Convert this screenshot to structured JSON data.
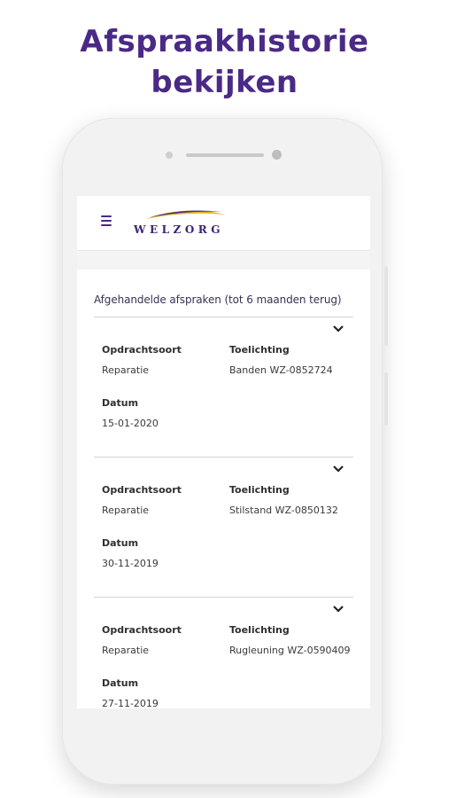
{
  "promo": {
    "title_line1": "Afspraakhistorie",
    "title_line2": "bekijken"
  },
  "header": {
    "logo_text": "WELZORG",
    "menu_icon": "hamburger-menu-icon"
  },
  "section": {
    "title": "Afgehandelde afspraken (tot 6 maanden terug)"
  },
  "labels": {
    "type": "Opdrachtsoort",
    "note": "Toelichting",
    "date": "Datum"
  },
  "appointments": [
    {
      "type": "Reparatie",
      "note": "Banden WZ-0852724",
      "date": "15-01-2020"
    },
    {
      "type": "Reparatie",
      "note": "Stilstand WZ-0850132",
      "date": "30-11-2019"
    },
    {
      "type": "Reparatie",
      "note": "Rugleuning WZ-0590409",
      "date": "27-11-2019"
    }
  ],
  "colors": {
    "brand_purple": "#4a2a86",
    "logo_gold": "#e3b720",
    "divider": "#d4d4d4"
  }
}
